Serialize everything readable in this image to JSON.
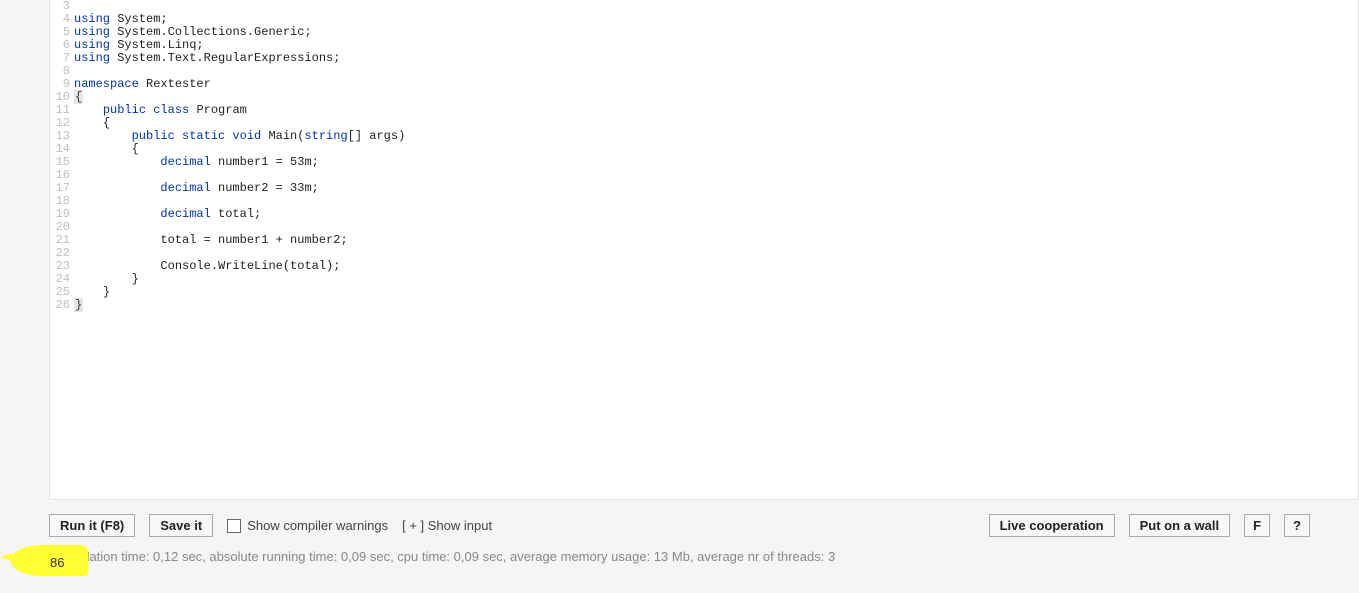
{
  "code": {
    "gutter": [
      "3",
      "4",
      "5",
      "6",
      "7",
      "8",
      "9",
      "10",
      "11",
      "12",
      "13",
      "14",
      "15",
      "16",
      "17",
      "18",
      "19",
      "20",
      "21",
      "22",
      "23",
      "24",
      "25",
      "26"
    ],
    "lines": [
      {
        "indent": "",
        "tokens": []
      },
      {
        "indent": "",
        "tokens": [
          {
            "t": "using ",
            "c": "kw-dir"
          },
          {
            "t": "System;",
            "c": "ident"
          }
        ]
      },
      {
        "indent": "",
        "tokens": [
          {
            "t": "using ",
            "c": "kw-dir"
          },
          {
            "t": "System.Collections.Generic;",
            "c": "ident"
          }
        ]
      },
      {
        "indent": "",
        "tokens": [
          {
            "t": "using ",
            "c": "kw-dir"
          },
          {
            "t": "System.Linq;",
            "c": "ident"
          }
        ]
      },
      {
        "indent": "",
        "tokens": [
          {
            "t": "using ",
            "c": "kw-dir"
          },
          {
            "t": "System.Text.RegularExpressions;",
            "c": "ident"
          }
        ]
      },
      {
        "indent": "",
        "tokens": []
      },
      {
        "indent": "",
        "tokens": [
          {
            "t": "namespace ",
            "c": "kw-dir"
          },
          {
            "t": "Rextester",
            "c": "ident"
          }
        ]
      },
      {
        "indent": "",
        "tokens": [
          {
            "t": "{",
            "c": "brace-box"
          }
        ]
      },
      {
        "indent": "    ",
        "tokens": [
          {
            "t": "public class ",
            "c": "kw-mod"
          },
          {
            "t": "Program",
            "c": "ident"
          }
        ]
      },
      {
        "indent": "    ",
        "tokens": [
          {
            "t": "{",
            "c": "brack"
          }
        ]
      },
      {
        "indent": "        ",
        "tokens": [
          {
            "t": "public static void ",
            "c": "kw-mod"
          },
          {
            "t": "Main(",
            "c": "ident"
          },
          {
            "t": "string",
            "c": "kw-type"
          },
          {
            "t": "[] args)",
            "c": "ident"
          }
        ]
      },
      {
        "indent": "        ",
        "tokens": [
          {
            "t": "{",
            "c": "brack"
          }
        ]
      },
      {
        "indent": "            ",
        "tokens": [
          {
            "t": "decimal ",
            "c": "kw-type"
          },
          {
            "t": "number1 = 53m;",
            "c": "ident"
          }
        ]
      },
      {
        "indent": "",
        "tokens": []
      },
      {
        "indent": "            ",
        "tokens": [
          {
            "t": "decimal ",
            "c": "kw-type"
          },
          {
            "t": "number2 = 33m;",
            "c": "ident"
          }
        ]
      },
      {
        "indent": "",
        "tokens": []
      },
      {
        "indent": "            ",
        "tokens": [
          {
            "t": "decimal ",
            "c": "kw-type"
          },
          {
            "t": "total;",
            "c": "ident"
          }
        ]
      },
      {
        "indent": "",
        "tokens": []
      },
      {
        "indent": "            ",
        "tokens": [
          {
            "t": "total = number1 + number2;",
            "c": "ident"
          }
        ]
      },
      {
        "indent": "",
        "tokens": []
      },
      {
        "indent": "            ",
        "tokens": [
          {
            "t": "Console.WriteLine(total);",
            "c": "ident"
          }
        ]
      },
      {
        "indent": "        ",
        "tokens": [
          {
            "t": "}",
            "c": "brack"
          }
        ]
      },
      {
        "indent": "    ",
        "tokens": [
          {
            "t": "}",
            "c": "brack"
          }
        ]
      },
      {
        "indent": "",
        "tokens": [
          {
            "t": "}",
            "c": "brace-box"
          }
        ]
      }
    ]
  },
  "toolbar": {
    "run_label": "Run it (F8)",
    "save_label": "Save it",
    "show_warnings_label": "Show compiler warnings",
    "show_input_label": "[ + ] Show input",
    "live_coop_label": "Live cooperation",
    "put_wall_label": "Put on a wall",
    "f_label": "F",
    "q_label": "?"
  },
  "status": {
    "text": "Compilation time: 0,12 sec, absolute running time: 0,09 sec, cpu time: 0,09 sec, average memory usage: 13 Mb, average nr of threads: 3"
  },
  "output": {
    "value": "86"
  }
}
